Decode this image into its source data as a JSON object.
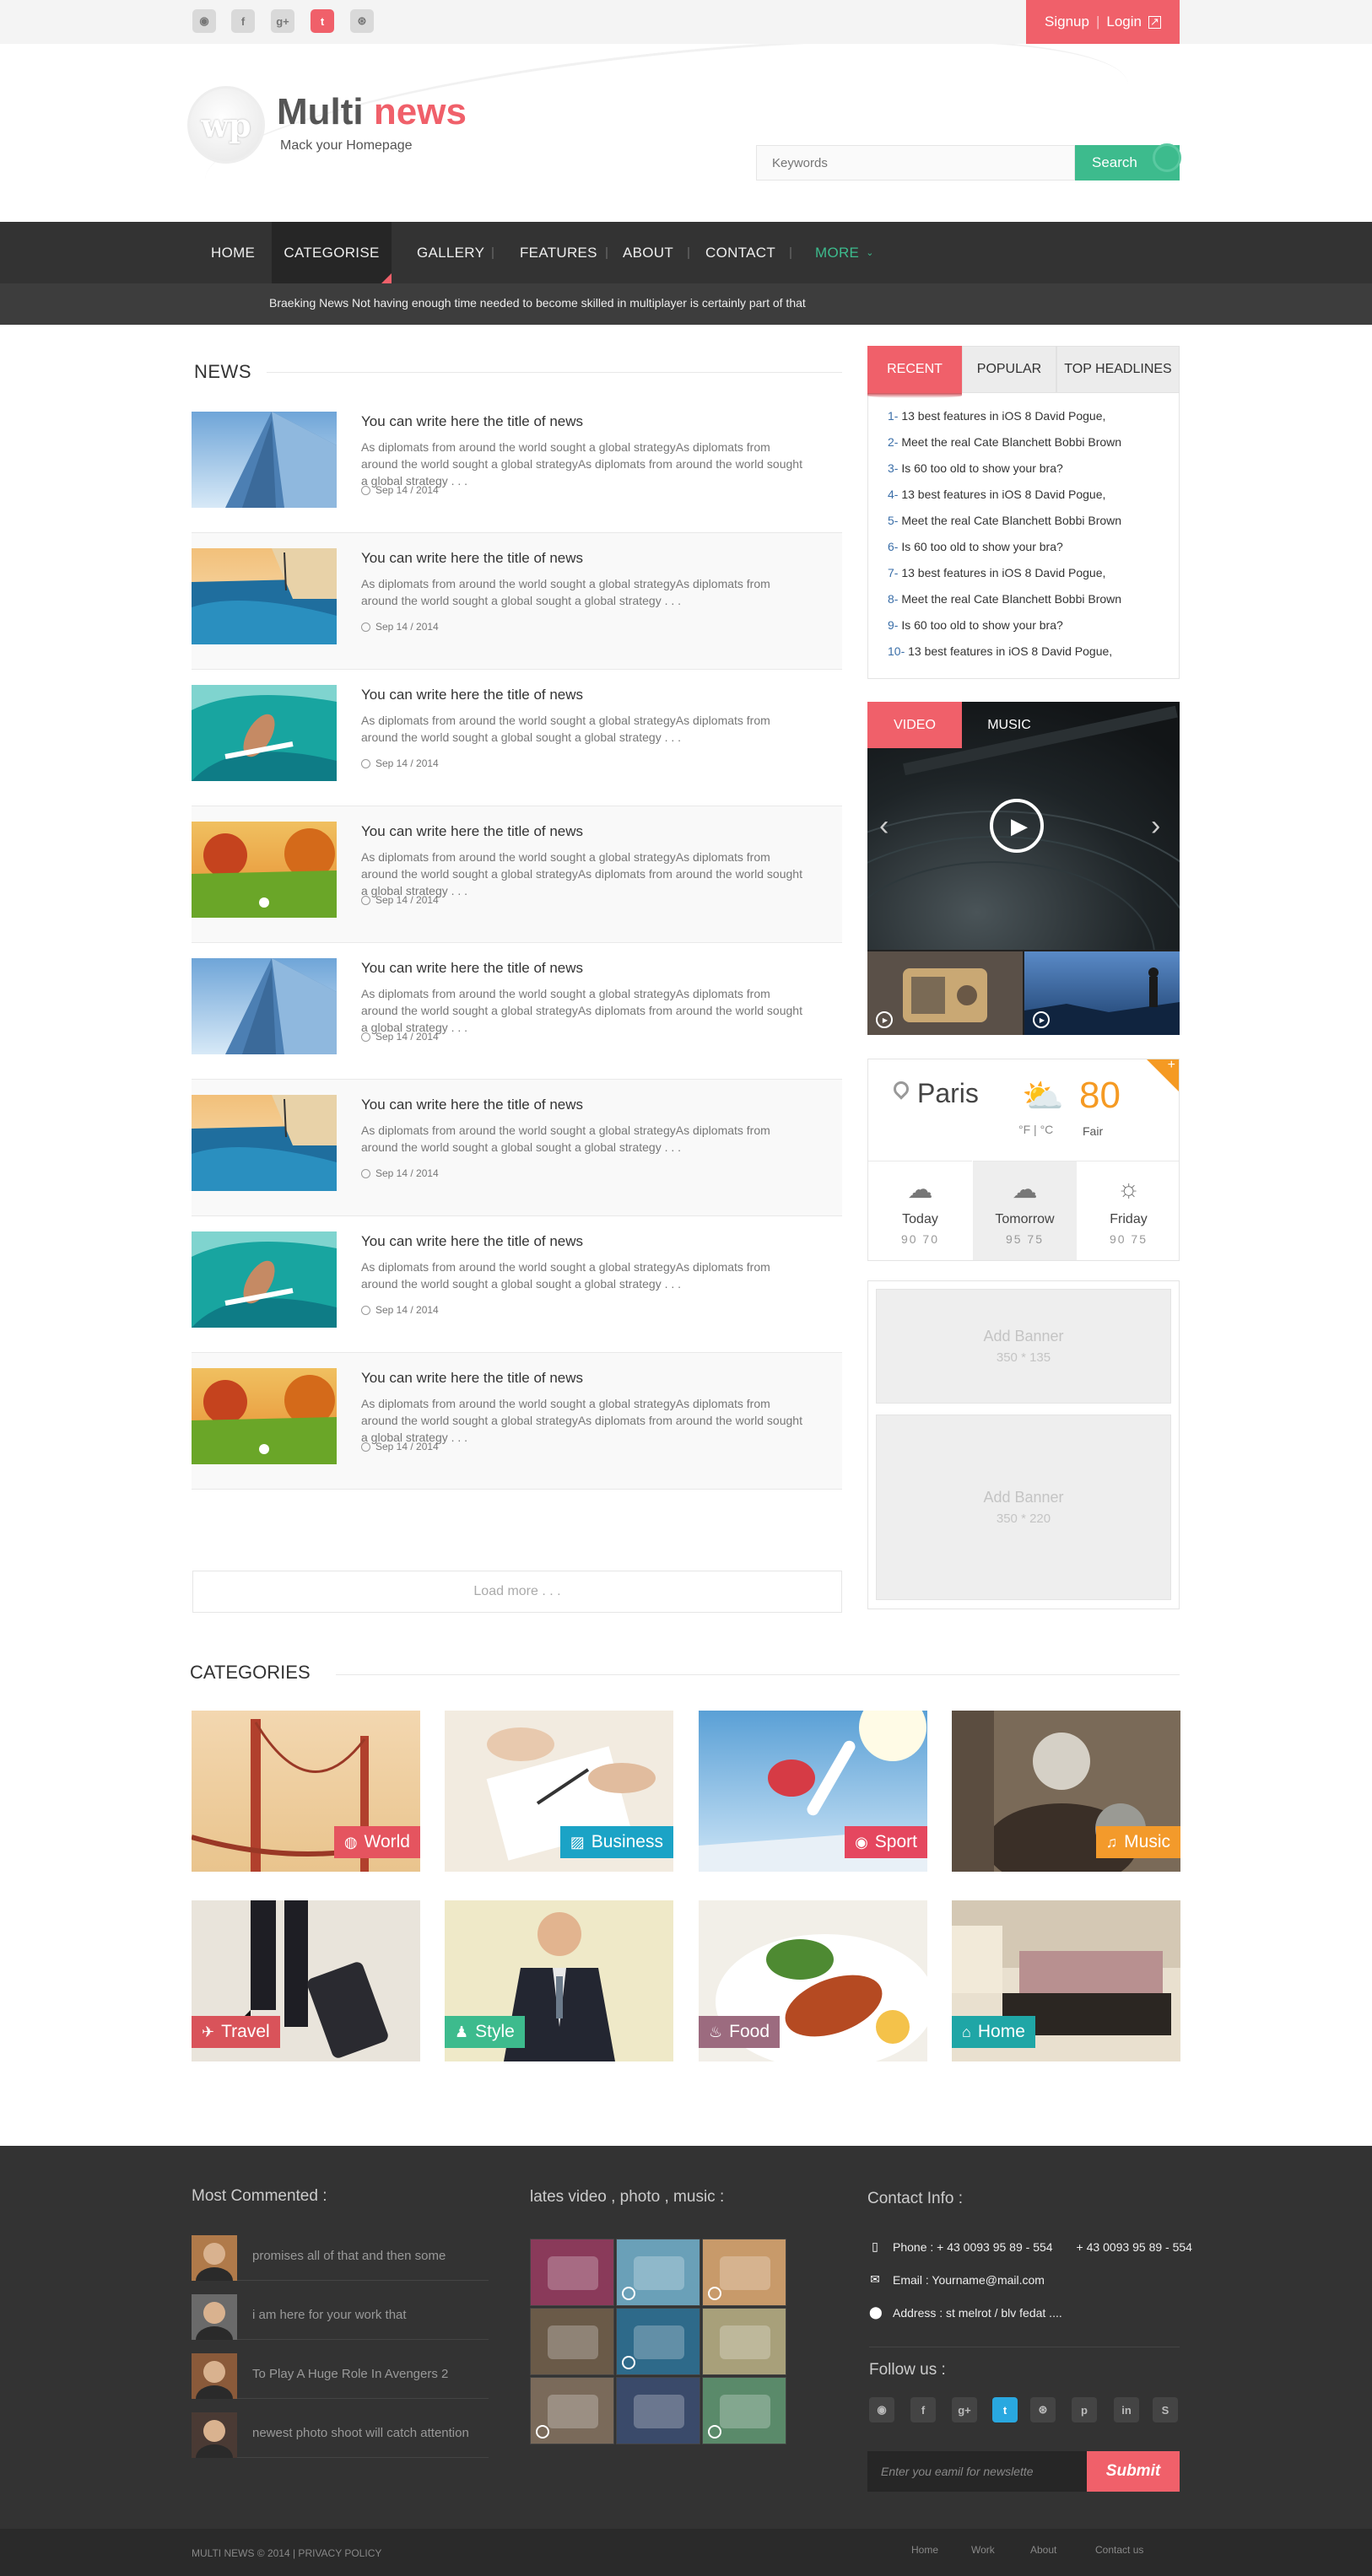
{
  "topbar": {
    "social": [
      "rss-icon",
      "facebook-icon",
      "google-plus-icon",
      "twitter-icon",
      "dribbble-icon"
    ],
    "signup": "Signup",
    "login": "Login"
  },
  "header": {
    "logo_mark": "wp",
    "logo_main": "Multi",
    "logo_accent": "news",
    "tagline": "Mack your Homepage",
    "search_placeholder": "Keywords",
    "search_button": "Search"
  },
  "nav": {
    "items": [
      "HOME",
      "CATEGORISE",
      "GALLERY",
      "FEATURES",
      "ABOUT",
      "CONTACT",
      "MORE"
    ],
    "active": "CATEGORISE",
    "breaking": "Braeking News Not having enough time needed to become skilled in multiplayer is certainly part of that"
  },
  "news": {
    "heading": "NEWS",
    "items": [
      {
        "title": "You can write here the title of news",
        "text": "As diplomats from around the world sought a global strategyAs diplomats from around the world sought a global strategyAs diplomats from around the world sought a global strategy . . .",
        "date": "Sep 14 / 2014"
      },
      {
        "title": "You can write here the title of news",
        "text": "As diplomats from around the world sought a global strategyAs diplomats from around the world sought a global sought a global strategy . . .",
        "date": "Sep 14 / 2014"
      },
      {
        "title": "You can write here the title of news",
        "text": "As diplomats from around the world sought a global strategyAs diplomats from around the world sought a global sought a global strategy . . .",
        "date": "Sep 14 / 2014"
      },
      {
        "title": "You can write here the title of news",
        "text": "As diplomats from around the world sought a global strategyAs diplomats from around the world sought a global strategyAs diplomats from around the world sought a global strategy . . .",
        "date": "Sep 14 / 2014"
      },
      {
        "title": "You can write here the title of news",
        "text": "As diplomats from around the world sought a global strategyAs diplomats from around the world sought a global strategyAs diplomats from around the world sought a global strategy . . .",
        "date": "Sep 14 / 2014"
      },
      {
        "title": "You can write here the title of news",
        "text": "As diplomats from around the world sought a global strategyAs diplomats from around the world sought a global sought a global strategy . . .",
        "date": "Sep 14 / 2014"
      },
      {
        "title": "You can write here the title of news",
        "text": "As diplomats from around the world sought a global strategyAs diplomats from around the world sought a global sought a global strategy . . .",
        "date": "Sep 14 / 2014"
      },
      {
        "title": "You can write here the title of news",
        "text": "As diplomats from around the world sought a global strategyAs diplomats from around the world sought a global strategyAs diplomats from around the world sought a global strategy . . .",
        "date": "Sep 14 / 2014"
      }
    ],
    "load_more": "Load more . . ."
  },
  "sidebar": {
    "tabs": [
      "RECENT",
      "POPULAR",
      "TOP HEADLINES"
    ],
    "list": [
      {
        "num": "1-",
        "text": "13 best features in iOS 8 David Pogue,"
      },
      {
        "num": "2-",
        "text": "Meet the real Cate Blanchett Bobbi Brown"
      },
      {
        "num": "3-",
        "text": "Is 60 too old to show your bra?"
      },
      {
        "num": "4-",
        "text": "13 best features in iOS 8 David Pogue,"
      },
      {
        "num": "5-",
        "text": "Meet the real Cate Blanchett Bobbi Brown"
      },
      {
        "num": "6-",
        "text": "Is 60 too old to show your bra?"
      },
      {
        "num": "7-",
        "text": "13 best features in iOS 8 David Pogue,"
      },
      {
        "num": "8-",
        "text": "Meet the real Cate Blanchett Bobbi Brown"
      },
      {
        "num": "9-",
        "text": "Is 60 too old to show your bra?"
      },
      {
        "num": "10-",
        "text": "13 best features in iOS 8 David Pogue,"
      }
    ],
    "media_tabs": [
      "VIDEO",
      "MUSIC"
    ],
    "weather": {
      "city": "Paris",
      "temp": "80",
      "unit": "°F | °C",
      "condition": "Fair",
      "days": [
        {
          "day": "Today",
          "temps": "90 70",
          "icon": "cloud-icon"
        },
        {
          "day": "Tomorrow",
          "temps": "95 75",
          "icon": "rain-cloud-icon"
        },
        {
          "day": "Friday",
          "temps": "90 75",
          "icon": "sun-icon"
        }
      ]
    },
    "banners": [
      {
        "label": "Add Banner",
        "size": "350 * 135"
      },
      {
        "label": "Add Banner",
        "size": "350 * 220"
      }
    ]
  },
  "categories": {
    "heading": "CATEGORIES",
    "items": [
      {
        "label": "World",
        "color": "#e5545f",
        "icon": "globe-icon"
      },
      {
        "label": "Business",
        "color": "#1ba3c6",
        "icon": "chart-icon"
      },
      {
        "label": "Sport",
        "color": "#e5475f",
        "icon": "ball-icon"
      },
      {
        "label": "Music",
        "color": "#f39a2b",
        "icon": "music-icon"
      },
      {
        "label": "Travel",
        "color": "#d9535a",
        "icon": "plane-icon"
      },
      {
        "label": "Style",
        "color": "#3dbb8d",
        "icon": "shirt-icon"
      },
      {
        "label": "Food",
        "color": "#9c6b7f",
        "icon": "chef-icon"
      },
      {
        "label": "Home",
        "color": "#1fa6a6",
        "icon": "house-icon"
      }
    ]
  },
  "footer": {
    "most_commented": "Most Commented :",
    "comments": [
      "promises all of that and then some",
      "i am here for your work that",
      "To Play A Huge Role In Avengers 2",
      "newest photo shoot will catch attention"
    ],
    "gallery_heading": "lates video , photo , music :",
    "contact_heading": "Contact Info :",
    "phone": "Phone : + 43 0093 95 89 - 554",
    "phone2": "+ 43 0093 95 89 - 554",
    "email": "Email : Yourname@mail.com",
    "address": "Address : st melrot / blv fedat ....",
    "follow": "Follow us :",
    "newsletter_placeholder": "Enter you eamil  for newslette",
    "submit": "Submit",
    "copyright": "MULTI NEWS  © 2014  |  PRIVACY POLICY",
    "links": [
      "Home",
      "Work",
      "About",
      "Contact us"
    ]
  }
}
